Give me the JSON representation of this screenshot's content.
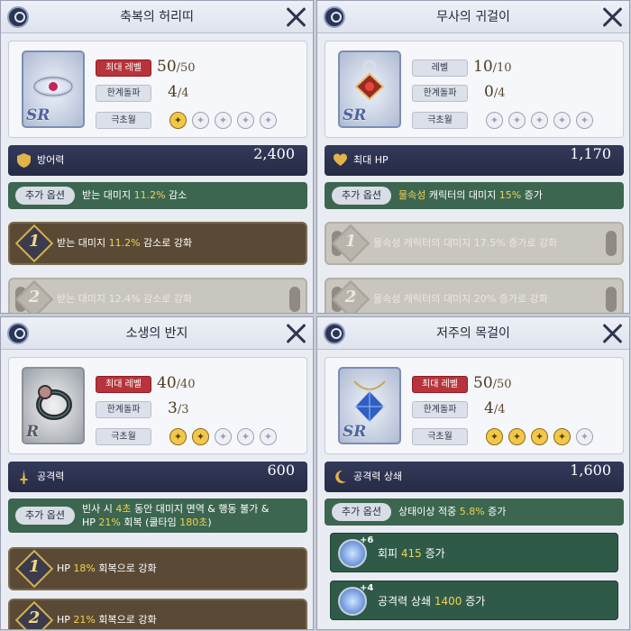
{
  "panels": [
    {
      "title": "축복의 허리띠",
      "grade": "SR",
      "level_label": "최대 레벨",
      "level_value": "50",
      "level_max": "/50",
      "level_is_max": true,
      "limit_label": "한계돌파",
      "limit_value": "4",
      "limit_max": "/4",
      "excel_label": "극초월",
      "stars_filled": 1,
      "stars_total": 5,
      "stat": {
        "icon": "shield-icon",
        "name": "방어력",
        "value": "2,400"
      },
      "option": {
        "label": "추가 옵션",
        "pre": "받는 대미지 ",
        "hl1": "11.2%",
        "mid": " 감소",
        "hl2": "",
        "post": ""
      },
      "tiers": [
        {
          "num": "1",
          "pre": "받는 대미지 ",
          "hl": "11.2%",
          "post": " 감소로 강화",
          "dim": false
        },
        {
          "num": "2",
          "pre": "받는 대미지 ",
          "hl": "12.4%",
          "post": " 감소로 강화",
          "dim": true
        }
      ]
    },
    {
      "title": "무사의 귀걸이",
      "grade": "SR",
      "level_label": "레벨",
      "level_value": "10",
      "level_max": "/10",
      "level_is_max": false,
      "limit_label": "한계돌파",
      "limit_value": "0",
      "limit_max": "/4",
      "excel_label": "극초월",
      "stars_filled": 0,
      "stars_total": 5,
      "stat": {
        "icon": "heart-icon",
        "name": "최대 HP",
        "value": "1,170"
      },
      "option": {
        "label": "추가 옵션",
        "pre": "",
        "hl1": "물속성",
        "mid": " 캐릭터의 대미지 ",
        "hl2": "15%",
        "post": " 증가"
      },
      "tiers": [
        {
          "num": "1",
          "pre": "물속성 캐릭터의 대미지 ",
          "hl": "17.5%",
          "post": " 증가로 강화",
          "dim": true
        },
        {
          "num": "2",
          "pre": "물속성 캐릭터의 대미지 ",
          "hl": "20%",
          "post": " 증가로 강화",
          "dim": true
        }
      ]
    },
    {
      "title": "소생의 반지",
      "grade": "R",
      "level_label": "최대 레벨",
      "level_value": "40",
      "level_max": "/40",
      "level_is_max": true,
      "limit_label": "한계돌파",
      "limit_value": "3",
      "limit_max": "/3",
      "excel_label": "극초월",
      "stars_filled": 2,
      "stars_total": 5,
      "stat": {
        "icon": "sword-icon",
        "name": "공격력",
        "value": "600"
      },
      "option": {
        "label": "추가 옵션",
        "line1_pre": "빈사 시 ",
        "line1_hl": "4초",
        "line1_post": " 동안 대미지 면역 & 행동 불가 &",
        "line2_pre": "HP ",
        "line2_hl": "21%",
        "line2_mid": " 회복 (쿨타임 ",
        "line2_hl2": "180초",
        "line2_post": ")"
      },
      "tiers": [
        {
          "num": "1",
          "pre": "HP ",
          "hl": "18%",
          "post": " 회복으로 강화",
          "dim": false
        },
        {
          "num": "2",
          "pre": "HP ",
          "hl": "21%",
          "post": " 회복으로 강화",
          "dim": false
        }
      ]
    },
    {
      "title": "저주의 목걸이",
      "grade": "SR",
      "level_label": "최대 레벨",
      "level_value": "50",
      "level_max": "/50",
      "level_is_max": true,
      "limit_label": "한계돌파",
      "limit_value": "4",
      "limit_max": "/4",
      "excel_label": "극초월",
      "stars_filled": 4,
      "stars_total": 5,
      "stat": {
        "icon": "crescent-icon",
        "name": "공격력 상쇄",
        "value": "1,600"
      },
      "option": {
        "label": "추가 옵션",
        "pre": "상태이상 적중 ",
        "hl1": "5.8%",
        "mid": " 증가",
        "hl2": "",
        "post": ""
      },
      "bonuses": [
        {
          "plus": "+6",
          "pre": "회피 ",
          "hl": "415",
          "post": " 증가"
        },
        {
          "plus": "+4",
          "pre": "공격력 상쇄 ",
          "hl": "1400",
          "post": " 증가"
        }
      ]
    }
  ]
}
